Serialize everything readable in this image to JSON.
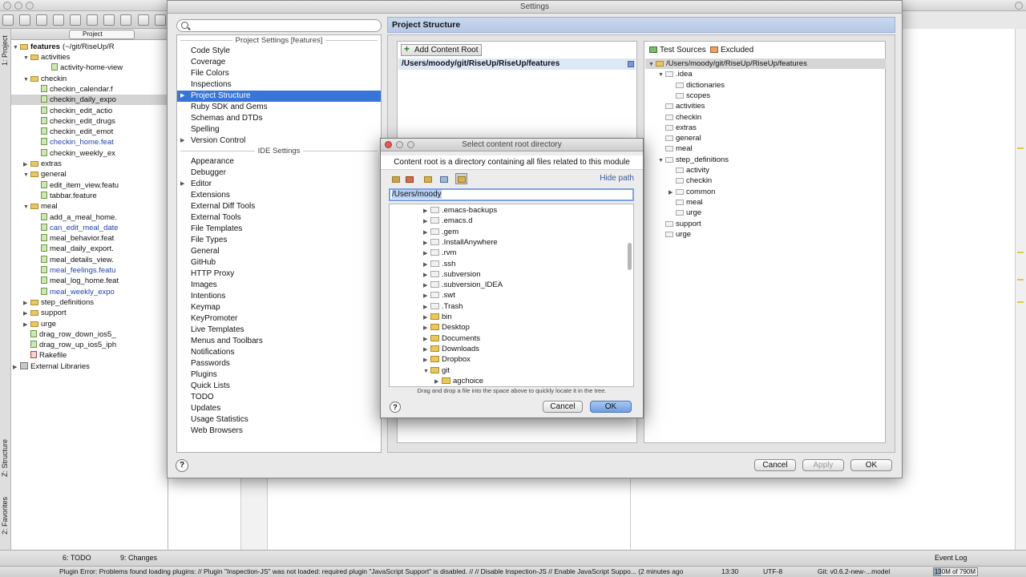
{
  "settings": {
    "title": "Settings",
    "search": {
      "value": ""
    },
    "groups": {
      "project": "Project Settings [features]",
      "ide": "IDE Settings"
    },
    "project_items": [
      "Code Style",
      "Coverage",
      "File Colors",
      "Inspections",
      "Project Structure",
      "Ruby SDK and Gems",
      "Schemas and DTDs",
      "Spelling",
      "Version Control"
    ],
    "ide_items": [
      "Appearance",
      "Debugger",
      "Editor",
      "Extensions",
      "External Diff Tools",
      "External Tools",
      "File Templates",
      "File Types",
      "General",
      "GitHub",
      "HTTP Proxy",
      "Images",
      "Intentions",
      "Keymap",
      "KeyPromoter",
      "Live Templates",
      "Menus and Toolbars",
      "Notifications",
      "Passwords",
      "Plugins",
      "Quick Lists",
      "TODO",
      "Updates",
      "Usage Statistics",
      "Web Browsers"
    ],
    "pane_title": "Project Structure",
    "add_content_root": "Add Content Root",
    "content_root_path": "/Users/moody/git/RiseUp/RiseUp/features",
    "test_sources": "Test Sources",
    "excluded": "Excluded",
    "root_tree": [
      "/Users/moody/git/RiseUp/RiseUp/features",
      ".idea",
      "dictionaries",
      "scopes",
      "activities",
      "checkin",
      "extras",
      "general",
      "meal",
      "step_definitions",
      "activity",
      "checkin",
      "common",
      "meal",
      "urge",
      "support",
      "urge"
    ],
    "buttons": {
      "cancel": "Cancel",
      "apply": "Apply",
      "ok": "OK"
    },
    "help": "?"
  },
  "chooser": {
    "title": "Select content root directory",
    "description": "Content root is a directory containing all files related to this module",
    "hide_path": "Hide path",
    "path_value": "/Users/moody",
    "tree": [
      ".emacs-backups",
      ".emacs.d",
      ".gem",
      ".InstallAnywhere",
      ".rvm",
      ".ssh",
      ".subversion",
      ".subversion_IDEA",
      ".swt",
      ".Trash",
      "bin",
      "Desktop",
      "Documents",
      "Downloads",
      "Dropbox",
      "git",
      "agchoice"
    ],
    "drag_hint": "Drag and drop a file into the space above to quickly locate it in the tree.",
    "buttons": {
      "cancel": "Cancel",
      "ok": "OK"
    },
    "help": "?"
  },
  "project": {
    "combo": "Project",
    "root": "features",
    "root_path": "(~/git/RiseUp/R",
    "rows": [
      "activities",
      "activity-home-view",
      "checkin",
      "checkin_calendar.f",
      "checkin_daily_expo",
      "checkin_edit_actio",
      "checkin_edit_drugs",
      "checkin_edit_emot",
      "checkin_home.feat",
      "checkin_weekly_ex",
      "extras",
      "general",
      "edit_item_view.featu",
      "tabbar.feature",
      "meal",
      "add_a_meal_home.",
      "can_edit_meal_date",
      "meal_behavior.feat",
      "meal_daily_export.",
      "meal_details_view.",
      "meal_feelings.featu",
      "meal_log_home.feat",
      "meal_weekly_expo",
      "step_definitions",
      "support",
      "urge",
      "drag_row_down_ios5_",
      "drag_row_up_ios5_iph",
      "Rakefile",
      "External Libraries"
    ]
  },
  "side_tabs": {
    "project": "1: Project",
    "structure": "Z: Structure",
    "favorites": "2: Favorites"
  },
  "bottom_tabs": {
    "todo": "6: TODO",
    "changes": "9: Changes",
    "event_log": "Event Log"
  },
  "status": {
    "message": "Plugin Error: Problems found loading plugins: // Plugin \"Inspection-JS\" was not loaded: required plugin \"JavaScript Support\" is disabled. // // Disable Inspection-JS // Enable JavaScript Suppo... (2 minutes ago)",
    "time": "13:30",
    "encoding": "UTF-8",
    "vcs": "Git: v0.6.2-new-...model",
    "memory": "130M of 790M",
    "memory_fraction": 0.16
  }
}
